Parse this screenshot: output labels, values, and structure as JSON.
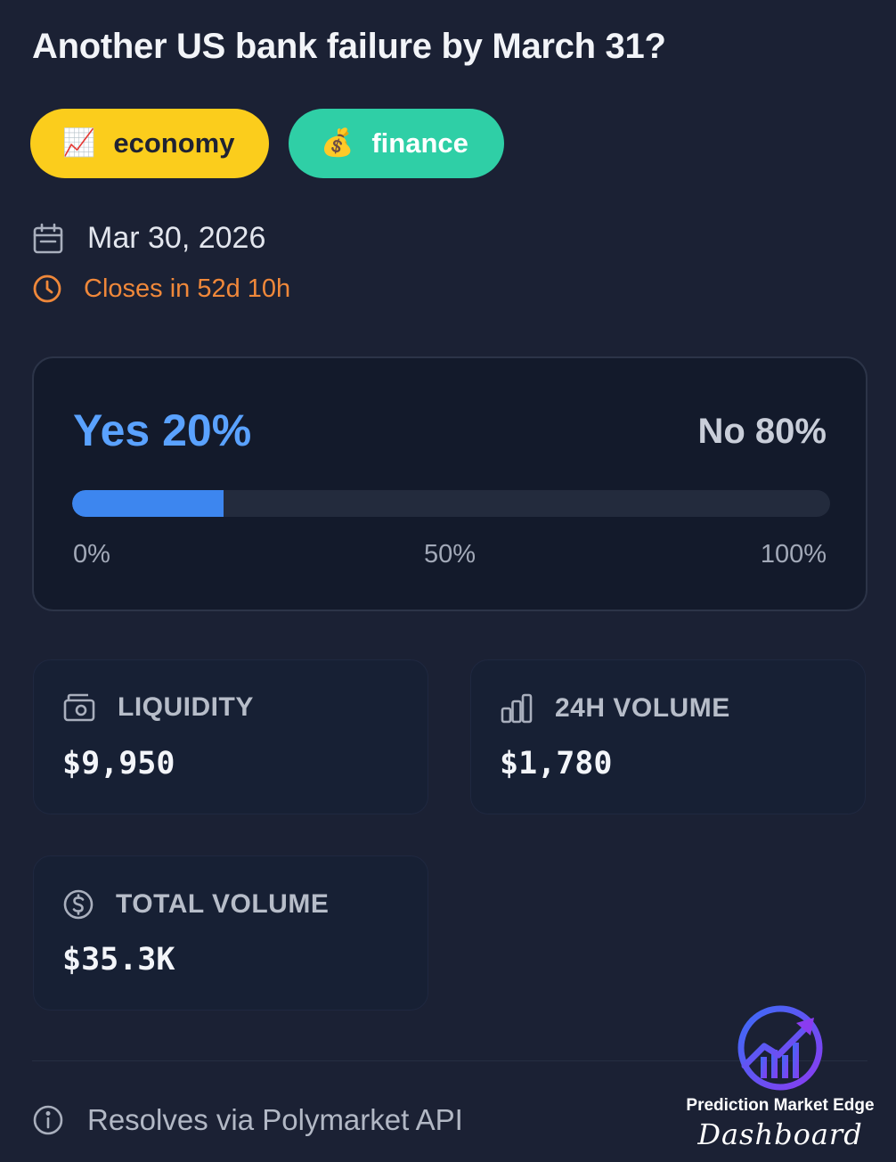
{
  "market": {
    "title": "Another US bank failure by March 31?",
    "tags": [
      {
        "label": "economy",
        "emoji": "📈",
        "icon": "chart-increasing-icon",
        "color": "#fbcd1c"
      },
      {
        "label": "finance",
        "emoji": "💰",
        "icon": "money-bag-icon",
        "color": "#2fcfa6"
      }
    ],
    "date": "Mar 30, 2026",
    "closes_in": "Closes in 52d 10h"
  },
  "odds": {
    "yes_label": "Yes 20%",
    "no_label": "No 80%",
    "yes_fraction": 0.2,
    "scale": [
      "0%",
      "50%",
      "100%"
    ],
    "yes_color": "#5aa2ff",
    "bar_color": "#3d86ef"
  },
  "stats": {
    "liquidity": {
      "label": "LIQUIDITY",
      "value": "$9,950",
      "icon": "wallet-icon"
    },
    "volume_24h": {
      "label": "24H VOLUME",
      "value": "$1,780",
      "icon": "bar-chart-icon"
    },
    "total_volume": {
      "label": "TOTAL VOLUME",
      "value": "$35.3K",
      "icon": "dollar-circle-icon"
    }
  },
  "footer": {
    "text": "Resolves via Polymarket API",
    "icon": "info-icon"
  },
  "brand": {
    "name": "Prediction Market Edge",
    "subtitle": "Dashboard"
  },
  "colors": {
    "background": "#1b2134",
    "accent_orange": "#f0883a"
  }
}
